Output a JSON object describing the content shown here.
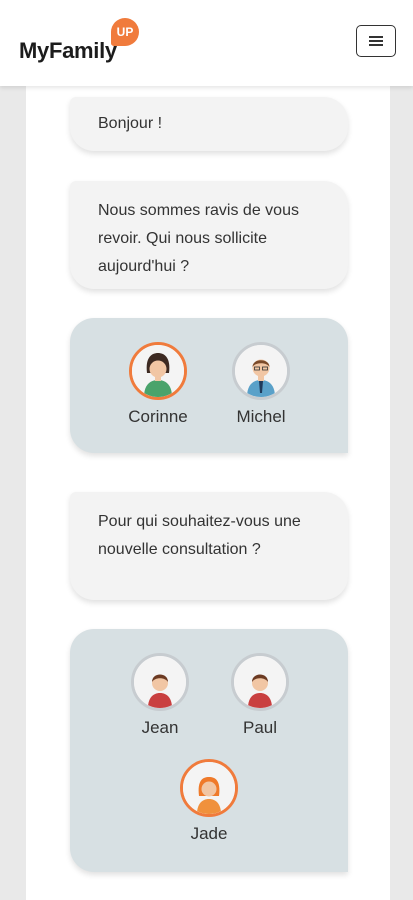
{
  "header": {
    "logo_text": "MyFamily",
    "logo_badge": "UP",
    "menu_icon": "hamburger-icon"
  },
  "messages": [
    {
      "text": "Bonjour !"
    },
    {
      "text": "Nous sommes ravis de vous revoir. Qui nous sollicite aujourd'hui ?"
    },
    {
      "text": "Pour qui souhaitez-vous une nouvelle consultation ?"
    }
  ],
  "requester_choice": {
    "people": [
      {
        "name": "Corinne",
        "selected": true
      },
      {
        "name": "Michel",
        "selected": false
      }
    ]
  },
  "patient_choice": {
    "people": [
      {
        "name": "Jean",
        "selected": false
      },
      {
        "name": "Paul",
        "selected": false
      },
      {
        "name": "Jade",
        "selected": true
      }
    ]
  },
  "colors": {
    "accent": "#f07b3c",
    "choice_bg": "#d7e0e3",
    "bubble_bg": "#f3f3f3"
  }
}
